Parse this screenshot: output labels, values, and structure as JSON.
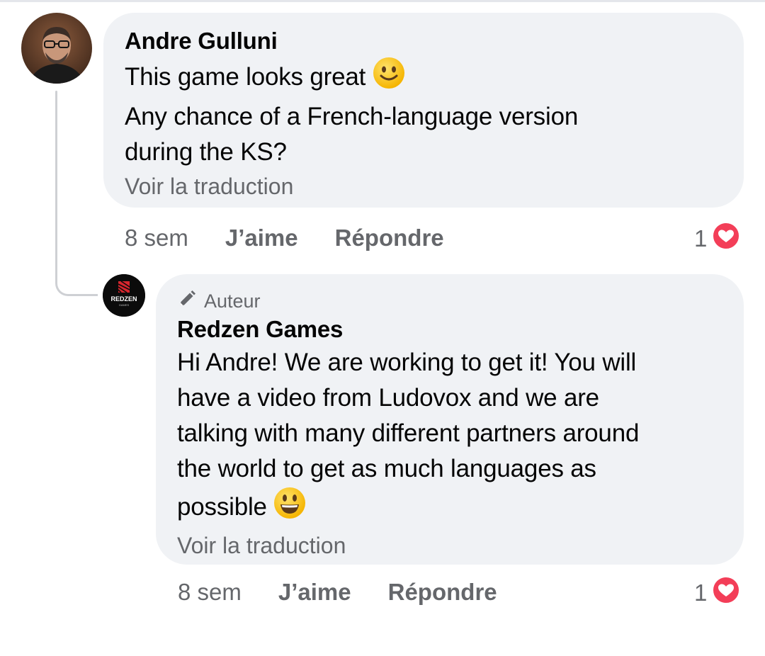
{
  "comments": [
    {
      "author": "Andre Gulluni",
      "line1": "This game looks great",
      "line2": "Any chance of a French-language version",
      "line3": "during the KS?",
      "translate_label": "Voir la traduction",
      "time": "8 sem",
      "like_label": "J’aime",
      "reply_label": "Répondre",
      "reaction_count": "1"
    },
    {
      "badge": "Auteur",
      "author": "Redzen Games",
      "lines": [
        "Hi Andre! We are working to get it! You will",
        "have a video from Ludovox and we are",
        "talking with many different partners around",
        "the world to get as much languages as",
        "possible"
      ],
      "translate_label": "Voir la traduction",
      "time": "8 sem",
      "like_label": "J’aime",
      "reply_label": "Répondre",
      "reaction_count": "1"
    }
  ],
  "logo_text": {
    "main": "REDZEN",
    "sub": "GAMES"
  },
  "icons": {
    "emoji_1": "slightly-smiling-face-emoji",
    "emoji_2": "grinning-face-emoji",
    "badge_icon": "pencil-icon",
    "reaction_icon": "love-heart-reaction-icon"
  },
  "colors": {
    "bubble_bg": "#f0f2f5",
    "meta_text": "#65676b",
    "love_red": "#f33e58",
    "thread_line": "#ced0d4"
  }
}
